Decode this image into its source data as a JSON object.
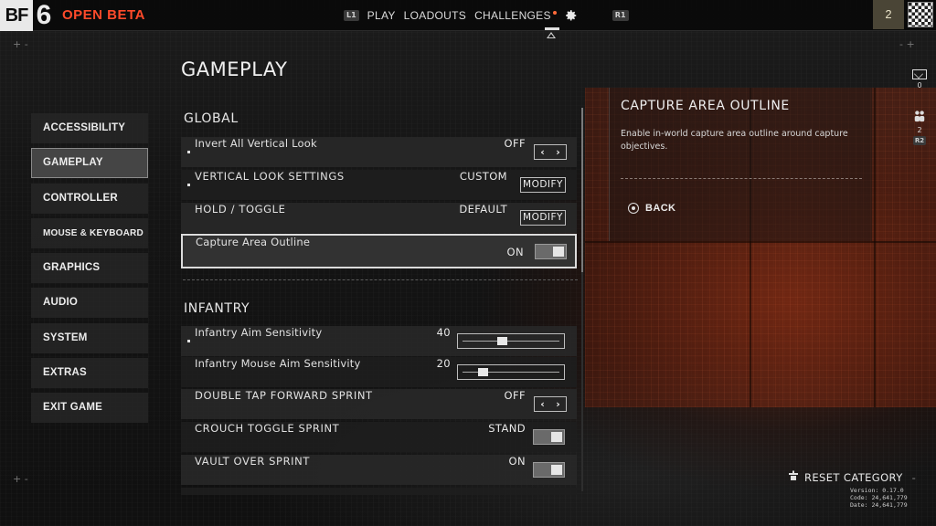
{
  "header": {
    "logo_bf": "BF",
    "logo_num": "6",
    "beta_label": "OPEN BETA",
    "hint_left": "L1",
    "nav": [
      "PLAY",
      "LOADOUTS",
      "CHALLENGES"
    ],
    "hint_right": "R1",
    "player_level": "2",
    "accent_color": "#ff4a2a"
  },
  "page": {
    "title": "GAMEPLAY"
  },
  "sidebar": {
    "items": [
      {
        "label": "ACCESSIBILITY"
      },
      {
        "label": "GAMEPLAY"
      },
      {
        "label": "CONTROLLER"
      },
      {
        "label": "MOUSE & KEYBOARD"
      },
      {
        "label": "GRAPHICS"
      },
      {
        "label": "AUDIO"
      },
      {
        "label": "SYSTEM"
      },
      {
        "label": "EXTRAS"
      },
      {
        "label": "EXIT GAME"
      }
    ],
    "active": "GAMEPLAY"
  },
  "global": {
    "heading": "GLOBAL",
    "rows": [
      {
        "label": "Invert All Vertical Look",
        "value": "OFF",
        "control": "arrows"
      },
      {
        "label": "VERTICAL LOOK SETTINGS",
        "value": "CUSTOM",
        "control": "modify",
        "action": "MODIFY"
      },
      {
        "label": "HOLD / TOGGLE",
        "value": "DEFAULT",
        "control": "modify",
        "action": "MODIFY"
      },
      {
        "label": "Capture Area Outline",
        "value": "ON",
        "control": "toggle"
      }
    ]
  },
  "infantry": {
    "heading": "INFANTRY",
    "rows": [
      {
        "label": "Infantry Aim Sensitivity",
        "value": "40",
        "control": "slider",
        "level": 0.4
      },
      {
        "label": "Infantry Mouse Aim Sensitivity",
        "value": "20",
        "control": "slider",
        "level": 0.2
      },
      {
        "label": "DOUBLE TAP FORWARD SPRINT",
        "value": "OFF",
        "control": "arrows"
      },
      {
        "label": "CROUCH TOGGLE SPRINT",
        "value": "STAND",
        "control": "toggle"
      },
      {
        "label": "VAULT OVER SPRINT",
        "value": "ON",
        "control": "toggle"
      }
    ]
  },
  "info_panel": {
    "title": "CAPTURE AREA OUTLINE",
    "description": "Enable in-world capture area outline around capture objectives.",
    "back_label": "BACK"
  },
  "right_rail": {
    "mail_count": "0",
    "squad_count": "2",
    "hint": "R2"
  },
  "footer": {
    "reset_label": "RESET CATEGORY",
    "version_line": "Version: 0.17.0",
    "code_line": "Code: 24,641,779",
    "date_line": "Date: 24,641,779"
  },
  "icons": {
    "gear": "gear-icon",
    "mail": "mail-icon",
    "squad": "squad-icon",
    "back": "circle-button-icon",
    "reset": "reset-icon"
  }
}
